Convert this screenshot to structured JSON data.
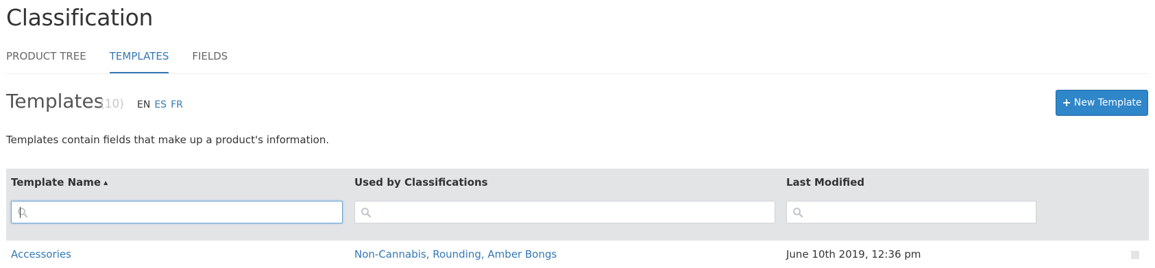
{
  "page": {
    "title": "Classification"
  },
  "tabs": [
    {
      "label": "PRODUCT TREE",
      "active": false
    },
    {
      "label": "TEMPLATES",
      "active": true
    },
    {
      "label": "FIELDS",
      "active": false
    }
  ],
  "section": {
    "title": "Templates",
    "count": "(10)",
    "languages": {
      "current": "EN",
      "others": [
        "ES",
        "FR"
      ]
    },
    "new_button_label": "New Template",
    "description": "Templates contain fields that make up a product's information."
  },
  "table": {
    "columns": [
      {
        "label": "Template Name",
        "sort": "ascending"
      },
      {
        "label": "Used by Classifications"
      },
      {
        "label": "Last Modified"
      }
    ],
    "filters": [
      {
        "value": "",
        "placeholder": ""
      },
      {
        "value": "",
        "placeholder": ""
      },
      {
        "value": "",
        "placeholder": ""
      }
    ],
    "rows": [
      {
        "name": "Accessories",
        "classifications": "Non-Cannabis, Rounding, Amber Bongs",
        "modified": "June 10th 2019, 12:36 pm"
      }
    ]
  },
  "colors": {
    "accent": "#3278b4",
    "button": "#2f86c9",
    "header_bg": "#e2e4e6"
  },
  "icons": {
    "new_button": "plus-icon",
    "sort": "sort-ascending-icon",
    "filter": "search-icon",
    "row_action": "row-action-icon"
  }
}
